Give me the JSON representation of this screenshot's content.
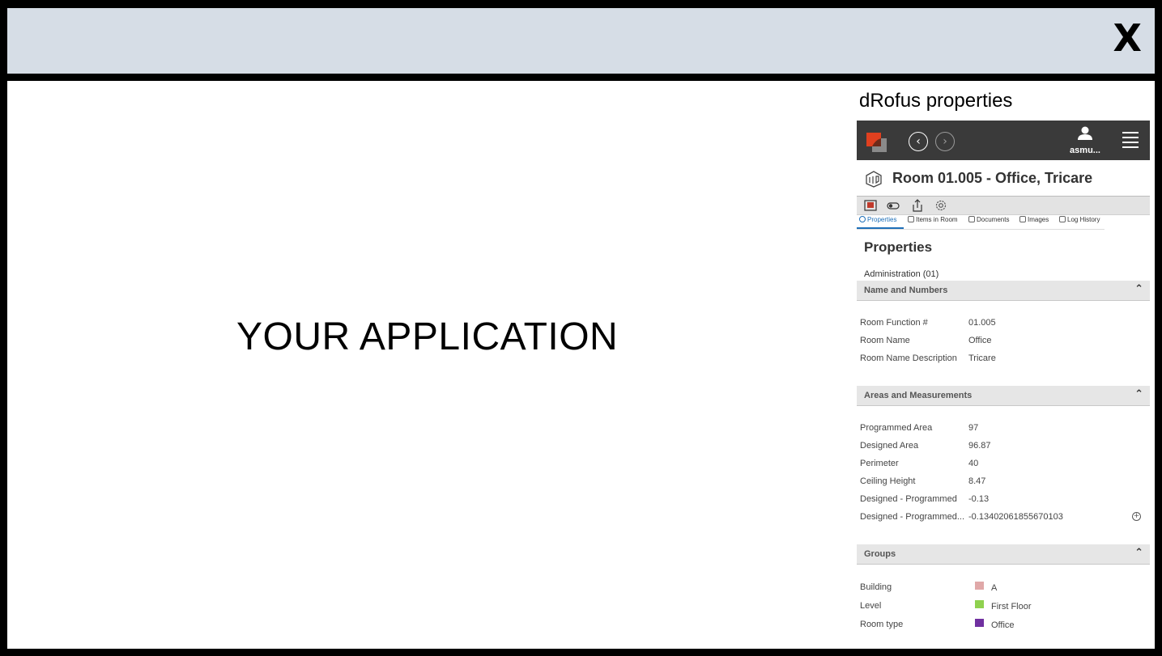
{
  "window": {
    "close_label": "X"
  },
  "app_placeholder": "YOUR APPLICATION",
  "panel": {
    "title": "dRofus properties",
    "header": {
      "user_name": "asmu...",
      "colors": {
        "bar": "#3a3a3a",
        "logo_red": "#e0401f",
        "logo_grey": "#8a8a8a"
      }
    },
    "room_title": "Room 01.005 - Office, Tricare",
    "toolbar_icons": [
      "room-image-icon",
      "toggle-icon",
      "share-icon",
      "settings-icon"
    ],
    "tabs": [
      {
        "label": "Properties",
        "icon": "info-icon",
        "active": true
      },
      {
        "label": "Items in Room",
        "icon": "items-icon",
        "active": false
      },
      {
        "label": "Documents",
        "icon": "document-icon",
        "active": false
      },
      {
        "label": "Images",
        "icon": "camera-icon",
        "active": false
      },
      {
        "label": "Log History",
        "icon": "log-icon",
        "active": false
      }
    ],
    "section_title": "Properties",
    "admin_label": "Administration (01)",
    "sections": {
      "name_numbers": {
        "title": "Name and Numbers",
        "rows": [
          {
            "key": "Room Function #",
            "value": "01.005"
          },
          {
            "key": "Room Name",
            "value": "Office"
          },
          {
            "key": "Room Name Description",
            "value": "Tricare"
          }
        ]
      },
      "areas": {
        "title": "Areas and Measurements",
        "rows": [
          {
            "key": "Programmed Area",
            "value": "97"
          },
          {
            "key": "Designed Area",
            "value": "96.87"
          },
          {
            "key": "Perimeter",
            "value": "40"
          },
          {
            "key": "Ceiling Height",
            "value": "8.47"
          },
          {
            "key": "Designed - Programmed",
            "value": "-0.13"
          },
          {
            "key": "Designed - Programmed...",
            "value": "-0.13402061855670103"
          }
        ]
      },
      "groups": {
        "title": "Groups",
        "rows": [
          {
            "key": "Building",
            "value": "A",
            "color": "#e0a8a8"
          },
          {
            "key": "Level",
            "value": "First Floor",
            "color": "#8fd14f"
          },
          {
            "key": "Room type",
            "value": "Office",
            "color": "#7030a0"
          }
        ]
      }
    }
  }
}
